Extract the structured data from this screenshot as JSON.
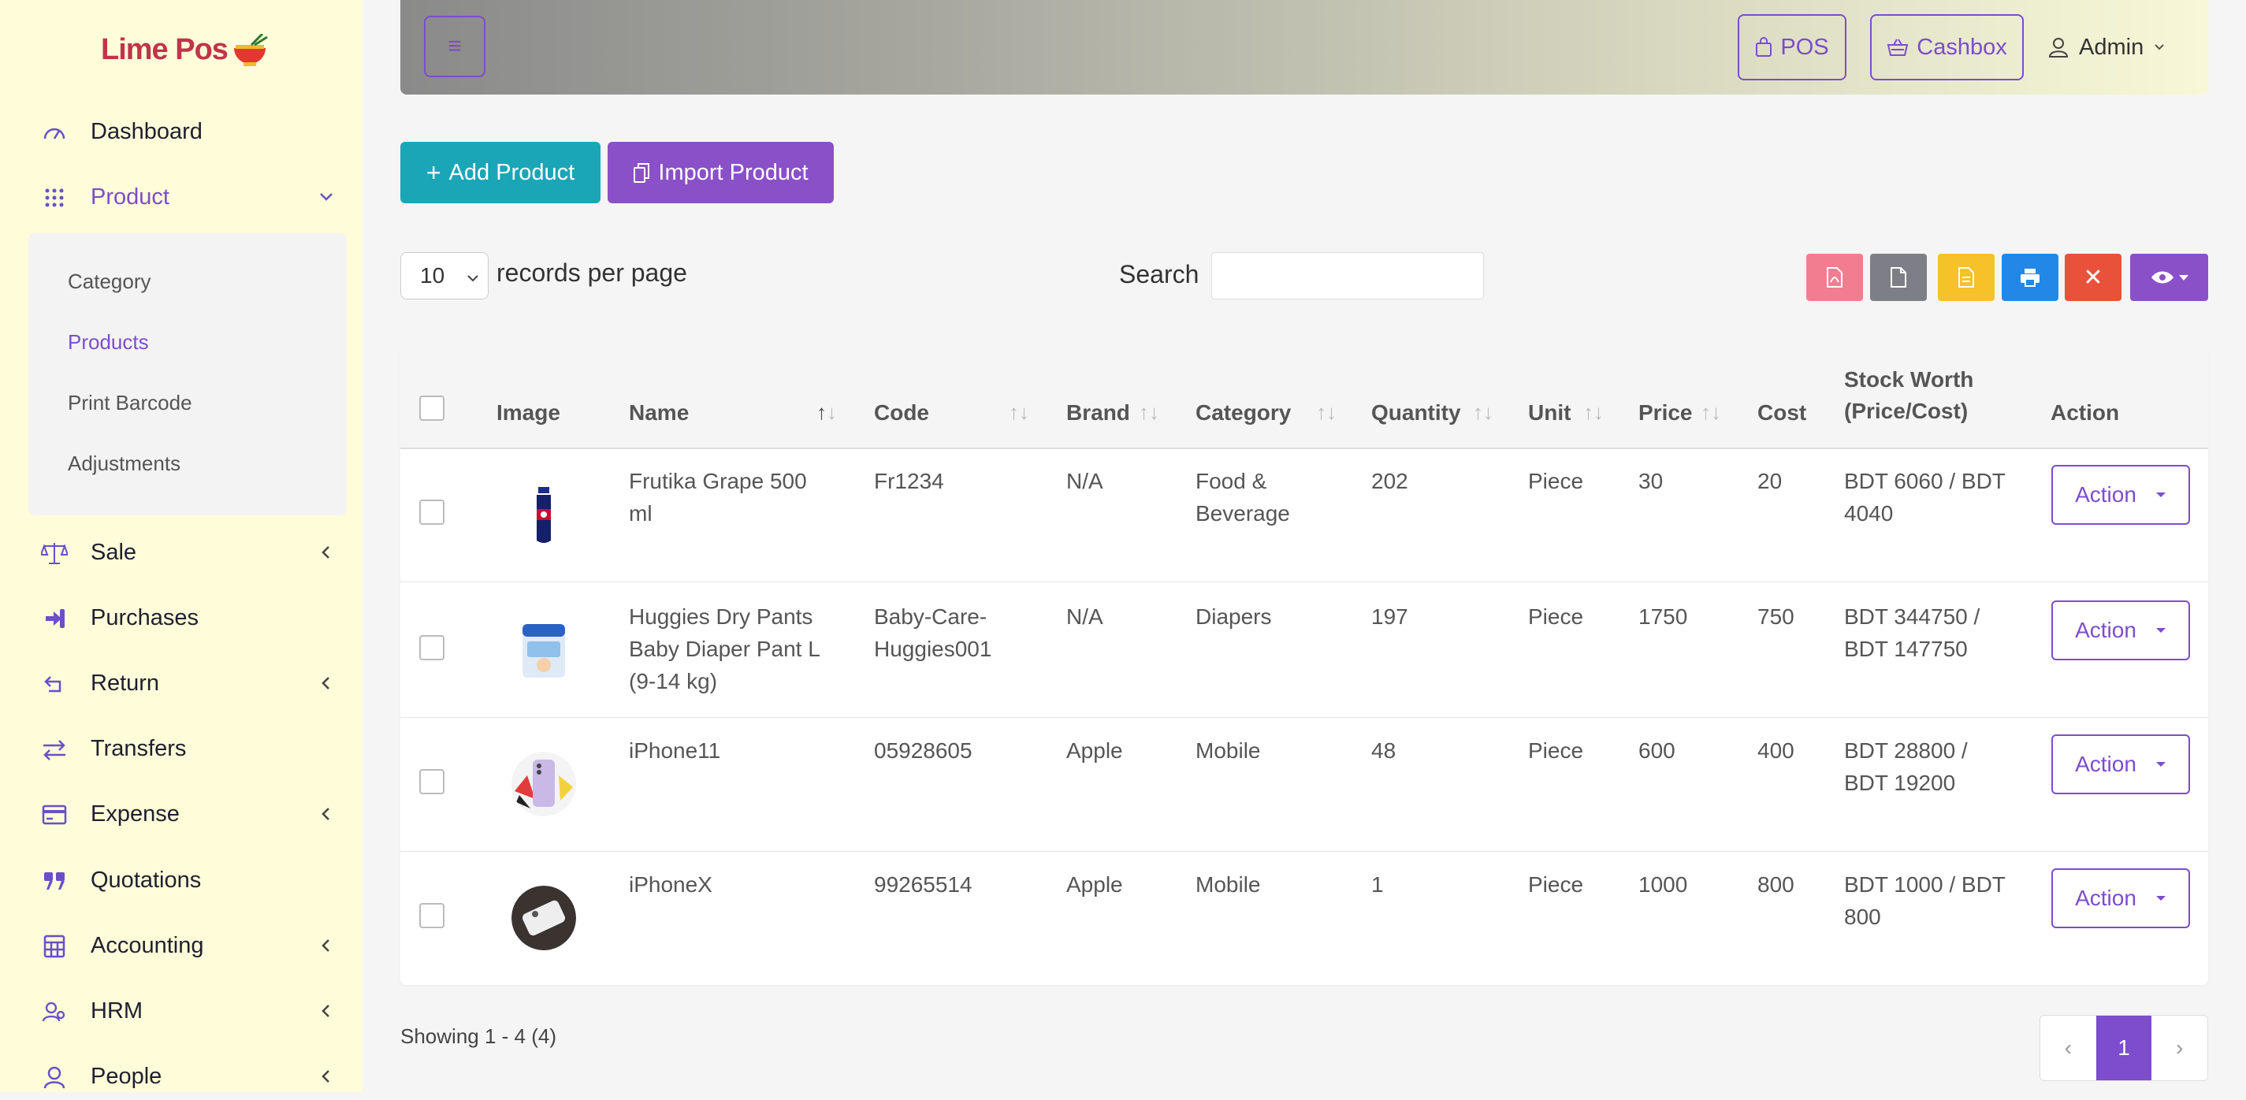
{
  "brand": {
    "logo_text": "Lime Pos"
  },
  "colors": {
    "accent": "#7c4dcc",
    "teal": "#1aa6b7",
    "sidebar_bg": "#fefcd9"
  },
  "sidebar": {
    "items": [
      {
        "label": "Dashboard",
        "icon": "gauge-icon"
      },
      {
        "label": "Product",
        "icon": "grid-dots-icon"
      },
      {
        "label": "Sale",
        "icon": "scale-icon"
      },
      {
        "label": "Purchases",
        "icon": "sign-in-icon"
      },
      {
        "label": "Return",
        "icon": "return-arrow-icon"
      },
      {
        "label": "Transfers",
        "icon": "transfer-arrows-icon"
      },
      {
        "label": "Expense",
        "icon": "credit-card-icon"
      },
      {
        "label": "Quotations",
        "icon": "quote-icon"
      },
      {
        "label": "Accounting",
        "icon": "calculator-icon"
      },
      {
        "label": "HRM",
        "icon": "users-icon"
      },
      {
        "label": "People",
        "icon": "user-icon"
      }
    ],
    "product_submenu": [
      "Category",
      "Products",
      "Print Barcode",
      "Adjustments"
    ]
  },
  "header": {
    "menu_icon": "hamburger-icon",
    "pos_label": "POS",
    "cashbox_label": "Cashbox",
    "user_label": "Admin"
  },
  "actions": {
    "add_product": "Add Product",
    "import_product": "Import Product"
  },
  "table_controls": {
    "page_size": "10",
    "records_label": "records per page",
    "search_label": "Search",
    "search_value": ""
  },
  "toolbar_icons": [
    "pdf-icon",
    "file-icon",
    "document-icon",
    "print-icon",
    "close-icon",
    "eye-icon"
  ],
  "table": {
    "columns": [
      "Image",
      "Name",
      "Code",
      "Brand",
      "Category",
      "Quantity",
      "Unit",
      "Price",
      "Cost",
      "Stock Worth (Price/Cost)",
      "Action"
    ],
    "stock_header_line1": "Stock Worth",
    "stock_header_line2": "(Price/Cost)",
    "rows": [
      {
        "name_lines": [
          "Frutika Grape 500",
          "ml"
        ],
        "code_lines": [
          "Fr1234"
        ],
        "brand": "N/A",
        "category_lines": [
          "Food &",
          "Beverage"
        ],
        "quantity": "202",
        "unit": "Piece",
        "price": "30",
        "cost": "20",
        "stock_lines": [
          "BDT 6060 / BDT",
          "4040"
        ],
        "action": "Action"
      },
      {
        "name_lines": [
          "Huggies Dry Pants",
          "Baby Diaper Pant L",
          "(9-14 kg)"
        ],
        "code_lines": [
          "Baby-Care-",
          "Huggies001"
        ],
        "brand": "N/A",
        "category_lines": [
          "Diapers"
        ],
        "quantity": "197",
        "unit": "Piece",
        "price": "1750",
        "cost": "750",
        "stock_lines": [
          "BDT 344750 /",
          "BDT 147750"
        ],
        "action": "Action"
      },
      {
        "name_lines": [
          "iPhone11"
        ],
        "code_lines": [
          "05928605"
        ],
        "brand": "Apple",
        "category_lines": [
          "Mobile"
        ],
        "quantity": "48",
        "unit": "Piece",
        "price": "600",
        "cost": "400",
        "stock_lines": [
          "BDT 28800 /",
          "BDT 19200"
        ],
        "action": "Action"
      },
      {
        "name_lines": [
          "iPhoneX"
        ],
        "code_lines": [
          "99265514"
        ],
        "brand": "Apple",
        "category_lines": [
          "Mobile"
        ],
        "quantity": "1",
        "unit": "Piece",
        "price": "1000",
        "cost": "800",
        "stock_lines": [
          "BDT 1000 / BDT",
          "800"
        ],
        "action": "Action"
      }
    ]
  },
  "footer": {
    "showing": "Showing 1 - 4 (4)",
    "current_page": "1",
    "prev": "‹",
    "next": "›"
  }
}
